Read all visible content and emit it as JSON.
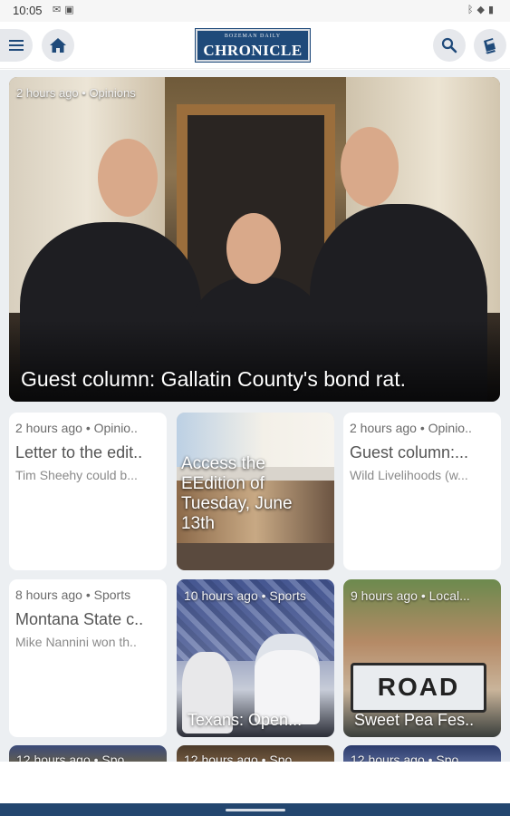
{
  "status_bar": {
    "time": "10:05",
    "left_icons": [
      "gmail-icon",
      "photo-icon"
    ],
    "right_icons": [
      "bluetooth-icon",
      "wifi-icon",
      "battery-icon"
    ]
  },
  "app_bar": {
    "logo_tagline": "BOZEMAN DAILY",
    "logo_name": "CHRONICLE",
    "accent_color": "#1f4a7a"
  },
  "hero": {
    "meta": "2 hours ago • Opinions",
    "title": "Guest column: Gallatin County's bond rat."
  },
  "cards": [
    {
      "meta": "2 hours ago • Opinio..",
      "title": "Letter to the edit..",
      "subtitle": "Tim Sheehy could b..."
    },
    {
      "meta": "",
      "title": "Access the EEdition of Tuesday, June 13th"
    },
    {
      "meta": "2 hours ago • Opinio..",
      "title": "Guest column:...",
      "subtitle": "Wild Livelihoods (w..."
    },
    {
      "meta": "8 hours ago • Sports",
      "title": "Montana State c..",
      "subtitle": "Mike Nannini won th.."
    },
    {
      "meta": "10 hours ago • Sports",
      "title": "Texans: Open..."
    },
    {
      "meta": "9 hours ago • Local...",
      "title": "Sweet Pea Fes..",
      "sign_text": "ROAD"
    }
  ],
  "row3": [
    {
      "meta": "12 hours ago • Spo.."
    },
    {
      "meta": "12 hours ago • Spo.."
    },
    {
      "meta": "12 hours ago • Spo.."
    }
  ],
  "colors": {
    "feed_background": "#eceff2",
    "nav_bar": "#23466f"
  }
}
